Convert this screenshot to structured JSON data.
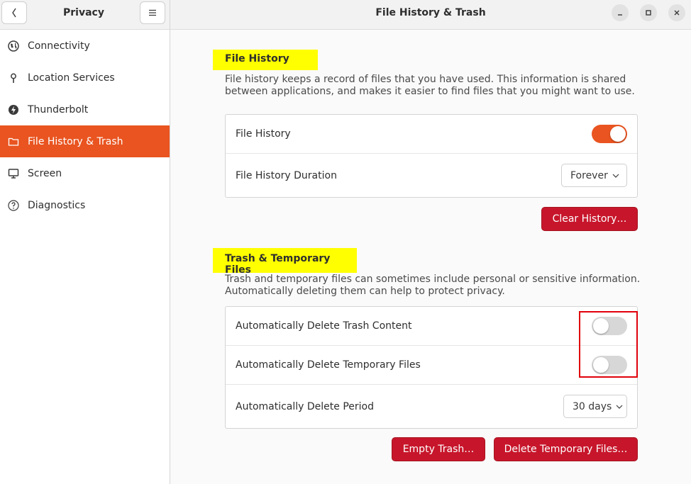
{
  "sidebar": {
    "title": "Privacy",
    "items": [
      {
        "label": "Connectivity",
        "icon": "globe-icon"
      },
      {
        "label": "Location Services",
        "icon": "location-pin-icon"
      },
      {
        "label": "Thunderbolt",
        "icon": "thunderbolt-icon"
      },
      {
        "label": "File History & Trash",
        "icon": "folder-icon",
        "active": true
      },
      {
        "label": "Screen",
        "icon": "monitor-icon"
      },
      {
        "label": "Diagnostics",
        "icon": "help-icon"
      }
    ]
  },
  "window": {
    "title": "File History & Trash"
  },
  "file_history": {
    "section_title": "File History",
    "description_line1": "File history keeps a record of files that you have used. This information is shared",
    "description_line2": "between applications, and makes it easier to find files that you might want to use.",
    "toggle_label": "File History",
    "toggle_on": true,
    "duration_label": "File History Duration",
    "duration_value": "Forever",
    "clear_button": "Clear History…"
  },
  "trash": {
    "section_title": "Trash & Temporary Files",
    "description_line1": "Trash and temporary files can sometimes include personal or sensitive information.",
    "description_line2": "Automatically deleting them can help to protect privacy.",
    "auto_trash_label": "Automatically Delete Trash Content",
    "auto_trash_on": false,
    "auto_temp_label": "Automatically Delete Temporary Files",
    "auto_temp_on": false,
    "period_label": "Automatically Delete Period",
    "period_value": "30 days",
    "empty_trash_button": "Empty Trash…",
    "delete_temp_button": "Delete Temporary Files…"
  },
  "colors": {
    "accent": "#e95420",
    "destructive": "#c7162b",
    "highlight": "#ffff00",
    "annotation": "#e0000a"
  }
}
